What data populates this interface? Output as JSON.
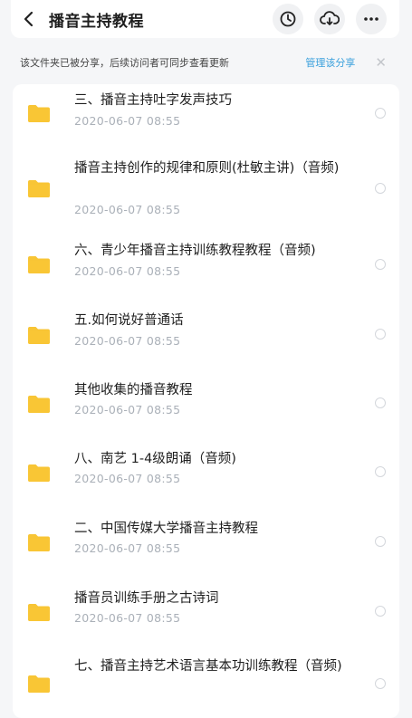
{
  "header": {
    "title": "播音主持教程"
  },
  "notice": {
    "message": "该文件夹已被分享，后续访问者可同步查看更新",
    "manage_label": "管理该分享",
    "close_glyph": "✕"
  },
  "colors": {
    "folder": "#f8c535",
    "accent": "#3aa0dc"
  },
  "files": [
    {
      "name": "三、播音主持吐字发声技巧",
      "date": "2020-06-07  08:55"
    },
    {
      "name": "播音主持创作的规律和原则(杜敏主讲)（音频)",
      "date": "2020-06-07  08:55"
    },
    {
      "name": "六、青少年播音主持训练教程教程（音频)",
      "date": "2020-06-07  08:55"
    },
    {
      "name": "五.如何说好普通话",
      "date": "2020-06-07  08:55"
    },
    {
      "name": "其他收集的播音教程",
      "date": "2020-06-07  08:55"
    },
    {
      "name": "八、南艺 1-4级朗诵（音频)",
      "date": "2020-06-07  08:55"
    },
    {
      "name": "二、中国传媒大学播音主持教程",
      "date": "2020-06-07  08:55"
    },
    {
      "name": "播音员训练手册之古诗词",
      "date": "2020-06-07  08:55"
    },
    {
      "name": "七、播音主持艺术语言基本功训练教程（音频)",
      "date": ""
    }
  ]
}
